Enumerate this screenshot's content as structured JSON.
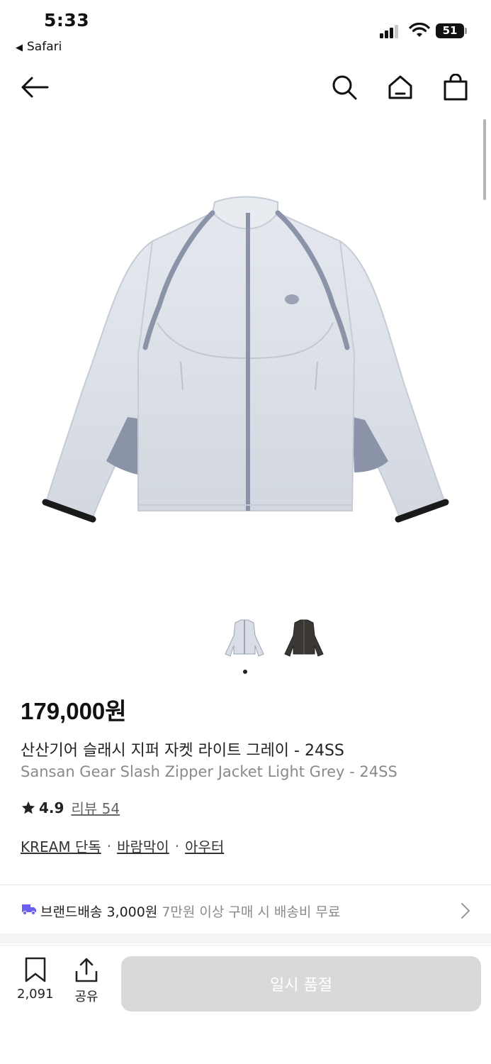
{
  "status_bar": {
    "time": "5:33",
    "back_app": "Safari",
    "battery": "51"
  },
  "nav": {
    "icons": [
      "back-arrow-icon",
      "search-icon",
      "home-icon",
      "shopping-bag-icon"
    ]
  },
  "product": {
    "price": "179,000원",
    "name_ko": "산산기어 슬래시 지퍼 자켓 라이트 그레이 - 24SS",
    "name_en": "Sansan Gear Slash Zipper Jacket Light Grey - 24SS",
    "rating": "4.9",
    "reviews": "리뷰 54",
    "tags": [
      "KREAM 단독",
      "바람막이",
      "아우터"
    ],
    "tag_separator": "·",
    "thumbnails": [
      "light-grey-jacket",
      "dark-brown-jacket"
    ]
  },
  "shipping": {
    "label": "브랜드배송 3,000원",
    "note": "7만원 이상 구매 시 배송비 무료"
  },
  "bottom_bar": {
    "save_count": "2,091",
    "share_label": "공유",
    "soldout_label": "일시 품절"
  },
  "colors": {
    "accent_truck": "#6B5FF0",
    "button_disabled": "#D9D9D9",
    "jacket_body": "#D9DEE6",
    "jacket_trim": "#8A93A8"
  }
}
